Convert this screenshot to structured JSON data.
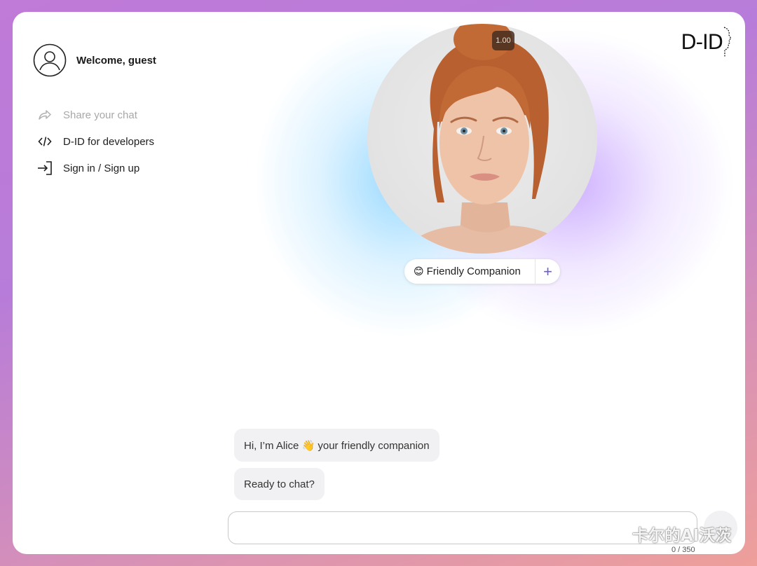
{
  "sidebar": {
    "welcome": "Welcome, guest",
    "items": [
      {
        "label": "Share your chat",
        "icon": "share-icon",
        "disabled": true
      },
      {
        "label": "D-ID for developers",
        "icon": "code-icon",
        "disabled": false
      },
      {
        "label": "Sign in / Sign up",
        "icon": "sign-in-icon",
        "disabled": false
      }
    ]
  },
  "logo": {
    "text": "D-ID"
  },
  "avatar_video": {
    "speed": "1.00",
    "image": "portrait-of-red-haired-woman"
  },
  "persona": {
    "emoji": "😊",
    "label": "Friendly Companion",
    "add_icon": "plus-icon"
  },
  "chat": {
    "messages": [
      {
        "text": "Hi, I’m Alice 👋 your friendly companion"
      },
      {
        "text": "Ready to chat?"
      }
    ],
    "input_value": "",
    "input_placeholder": "",
    "counter": "0 / 350"
  },
  "watermark": {
    "text": "卡尔的AI沃茨"
  },
  "colors": {
    "accent": "#6b5ae0",
    "bubble": "#f1f1f3",
    "glow_blue": "#7ccdff",
    "glow_purple": "#be96ff"
  }
}
